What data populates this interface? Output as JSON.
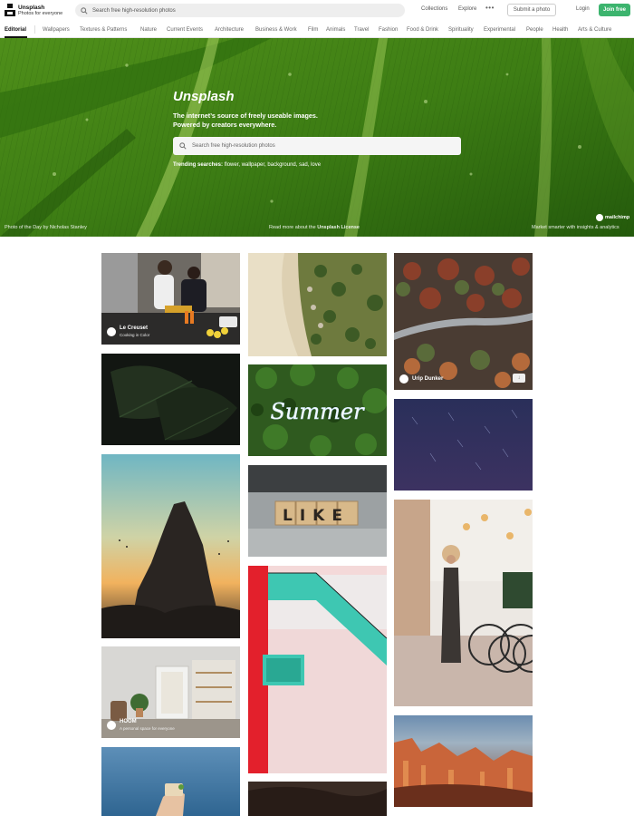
{
  "header": {
    "brand": {
      "name": "Unsplash",
      "tagline": "Photos for everyone"
    },
    "search_placeholder": "Search free high-resolution photos",
    "nav": [
      "Collections",
      "Explore"
    ],
    "more": "•••",
    "submit_label": "Submit a photo",
    "login_label": "Login",
    "join_label": "Join free",
    "join_color": "#3cb46e"
  },
  "categories": [
    "Editorial",
    "Wallpapers",
    "Textures & Patterns",
    "Nature",
    "Current Events",
    "Architecture",
    "Business & Work",
    "Film",
    "Animals",
    "Travel",
    "Fashion",
    "Food & Drink",
    "Spirituality",
    "Experimental",
    "People",
    "Health",
    "Arts & Culture"
  ],
  "hero": {
    "title": "Unsplash",
    "subtitle_line1": "The internet’s source of freely useable images.",
    "subtitle_line2": "Powered by creators everywhere.",
    "search_placeholder": "Search free high-resolution photos",
    "trending_label": "Trending searches:",
    "trending_terms": "flower, wallpaper, background, sad, love",
    "photo_of_day_prefix": "Photo of the Day",
    "photo_of_day_by": "by",
    "photo_of_day_author": "Nicholas Stanley",
    "license_prefix": "Read more about the",
    "license_link": "Unsplash License",
    "sponsor_name": "mailchimp",
    "sponsor_tagline": "Market smarter with insights & analytics"
  },
  "photos": {
    "kitchen": {
      "author": "Le Creuset",
      "desc": "Cooking in Color"
    },
    "forest": {
      "author": "Urip Dunker"
    },
    "room": {
      "author": "HOOM",
      "desc": "A personal space for everyone"
    },
    "summer_text": "Summer",
    "like_text": "LIKE"
  }
}
